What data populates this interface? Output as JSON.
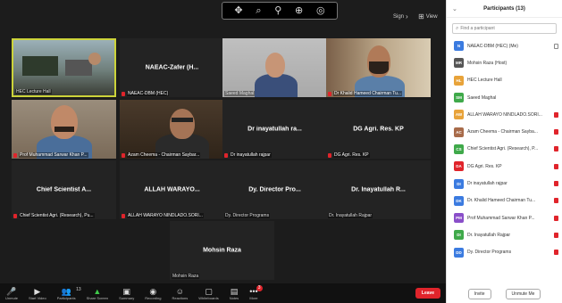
{
  "top_controls": [
    "✥",
    "⌕",
    "⚲",
    "⊕",
    "◎"
  ],
  "view_controls": {
    "sign_label": "Sign",
    "view_label": "View"
  },
  "tiles": [
    {
      "label": "HEC Lecture Hall",
      "kind": "video",
      "active": true,
      "mic_off": false
    },
    {
      "name": "NAEAC-Zafer  (H...",
      "label": "NAEAC-DBM (HEC)",
      "kind": "name",
      "mic_off": true
    },
    {
      "label": "Saeed Maghal",
      "kind": "video",
      "mic_off": false
    },
    {
      "label": "Dr Khalid Hameed Chairman Tu...",
      "kind": "video",
      "mic_off": true
    },
    {
      "label": "Prof Muhammad Sarwar Khan P...",
      "kind": "video",
      "mic_off": true
    },
    {
      "label": "Azam Cheema - Chairman Saybar...",
      "kind": "video",
      "mic_off": true
    },
    {
      "name": "Dr inayatullah ra...",
      "label": "Dr inayatullah rajpar",
      "kind": "name",
      "mic_off": true
    },
    {
      "name": "DG Agri. Res. KP",
      "label": "DG Agri. Res. KP",
      "kind": "name",
      "mic_off": true
    },
    {
      "name": "Chief Scientist A...",
      "label": "Chief Scientist Agri. (Research), Pu...",
      "kind": "name",
      "mic_off": true
    },
    {
      "name": "ALLAH WARAYO...",
      "label": "ALLAH WARAYO NINDLADO.SORI...",
      "kind": "name",
      "mic_off": true
    },
    {
      "name": "Dy. Director Pro...",
      "label": "Dy. Director Programs",
      "kind": "name",
      "mic_off": false
    },
    {
      "name": "Dr. Inayatullah R...",
      "label": "Dr. Inayatullah Rajpar",
      "kind": "name",
      "mic_off": false
    },
    {
      "name": "Mohsin Raza",
      "label": "Mohsin Raza",
      "kind": "name",
      "mic_off": false
    }
  ],
  "toolbar": {
    "items": [
      {
        "icon": "🎤",
        "label": "Unmute"
      },
      {
        "icon": "▶",
        "label": "Start Video"
      },
      {
        "icon": "👥",
        "label": "Participants",
        "count": "13"
      },
      {
        "icon": "▲",
        "label": "Share Screen",
        "green": true
      },
      {
        "icon": "▣",
        "label": "Summary"
      },
      {
        "icon": "◉",
        "label": "Recording"
      },
      {
        "icon": "☺",
        "label": "Reactions"
      },
      {
        "icon": "▢",
        "label": "Whiteboards"
      },
      {
        "icon": "▤",
        "label": "Notes"
      },
      {
        "icon": "•••",
        "label": "More",
        "badge": "3"
      }
    ],
    "leave_label": "Leave"
  },
  "panel": {
    "title": "Participants (13)",
    "search_placeholder": "Find a participant",
    "participants": [
      {
        "initials": "N",
        "color": "#3b7be0",
        "name": "NAEAC-DBM (HEC) (Me)",
        "mic": "on"
      },
      {
        "initials": "MR",
        "color": "#555555",
        "name": "Mohsin Raza (Host)",
        "mic": "none"
      },
      {
        "initials": "HL",
        "color": "#e8a33a",
        "name": "HEC Lecture Hall",
        "mic": "none"
      },
      {
        "initials": "SM",
        "color": "#3fa94a",
        "name": "Saeed Maghal",
        "mic": "none"
      },
      {
        "initials": "AW",
        "color": "#e8a33a",
        "name": "ALLAH WARAYO NINDLADO.SORI...",
        "mic": "off"
      },
      {
        "initials": "AC",
        "color": "#a86b4a",
        "name": "Azam Cheema - Chairman Sayba...",
        "mic": "off"
      },
      {
        "initials": "CS",
        "color": "#3fa94a",
        "name": "Chief Scientist Agri. (Research), P...",
        "mic": "off"
      },
      {
        "initials": "DA",
        "color": "#e0242b",
        "name": "DG Agri. Res. KP",
        "mic": "off"
      },
      {
        "initials": "DI",
        "color": "#3b7be0",
        "name": "Dr inayatullah rajpar",
        "mic": "off"
      },
      {
        "initials": "DK",
        "color": "#3b7be0",
        "name": "Dr. Khalid Hameed Chairman Tu...",
        "mic": "off"
      },
      {
        "initials": "PM",
        "color": "#8a4fc9",
        "name": "Prof Muhammad Sarwar Khan P...",
        "mic": "off"
      },
      {
        "initials": "DI",
        "color": "#3fa94a",
        "name": "Dr. Inayatullah Rajpar",
        "mic": "off"
      },
      {
        "initials": "DD",
        "color": "#3b7be0",
        "name": "Dy. Director Programs",
        "mic": "off"
      }
    ],
    "invite_label": "Invite",
    "unmute_label": "Unmute Me"
  }
}
